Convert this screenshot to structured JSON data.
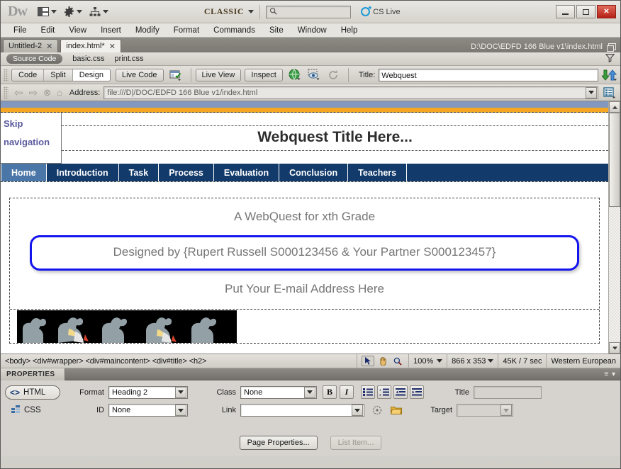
{
  "app": {
    "logo": "Dw",
    "workspace": "CLASSIC",
    "search_placeholder": "",
    "cs_live": "CS Live",
    "window_buttons": {
      "minimize": "—",
      "maximize": "❐",
      "close": "✕"
    }
  },
  "menubar": {
    "items": [
      "File",
      "Edit",
      "View",
      "Insert",
      "Modify",
      "Format",
      "Commands",
      "Site",
      "Window",
      "Help"
    ]
  },
  "doctabs": {
    "tabs": [
      {
        "label": "Untitled-2",
        "active": false
      },
      {
        "label": "index.html*",
        "active": true
      }
    ],
    "close_glyph": "✕",
    "document_path": "D:\\DOC\\EDFD 166 Blue v1\\index.html"
  },
  "related_files": {
    "source_code": "Source Code",
    "files": [
      "basic.css",
      "print.css"
    ]
  },
  "doc_toolbar": {
    "view_modes": [
      "Code",
      "Split",
      "Design"
    ],
    "active_view": "Design",
    "live_code": "Live Code",
    "live_view": "Live View",
    "inspect": "Inspect",
    "title_label": "Title:",
    "title_value": "Webquest"
  },
  "address_bar": {
    "label": "Address:",
    "value": "file:///D|/DOC/EDFD 166 Blue v1/index.html"
  },
  "page": {
    "skip_nav": "Skip navigation",
    "title": "Webquest Title Here...",
    "nav_items": [
      "Home",
      "Introduction",
      "Task",
      "Process",
      "Evaluation",
      "Conclusion",
      "Teachers"
    ],
    "subtitle": "A WebQuest for xth Grade",
    "designed_by": "Designed by {Rupert Russell S000123456 & Your Partner S000123457}",
    "email_line": "Put Your E-mail Address Here"
  },
  "statusbar": {
    "tag_selector": "<body> <div#wrapper> <div#maincontent> <div#title> <h2>",
    "zoom": "100%",
    "dimensions": "866 x 353",
    "download": "45K / 7 sec",
    "encoding": "Western European"
  },
  "properties": {
    "panel_title": "PROPERTIES",
    "html_tab": "HTML",
    "css_tab": "CSS",
    "format_label": "Format",
    "format_value": "Heading 2",
    "id_label": "ID",
    "id_value": "None",
    "class_label": "Class",
    "class_value": "None",
    "link_label": "Link",
    "link_value": "",
    "bold": "B",
    "italic": "I",
    "title_label": "Title",
    "title_value": "",
    "target_label": "Target",
    "target_value": "",
    "page_properties_button": "Page Properties...",
    "list_item_button": "List Item..."
  },
  "colors": {
    "nav_bar": "#123a6b",
    "nav_active": "#4a76a8",
    "accent_orange": "#f5a623",
    "selection_outline": "#1414ef",
    "page_topbar": "#8298bf"
  }
}
